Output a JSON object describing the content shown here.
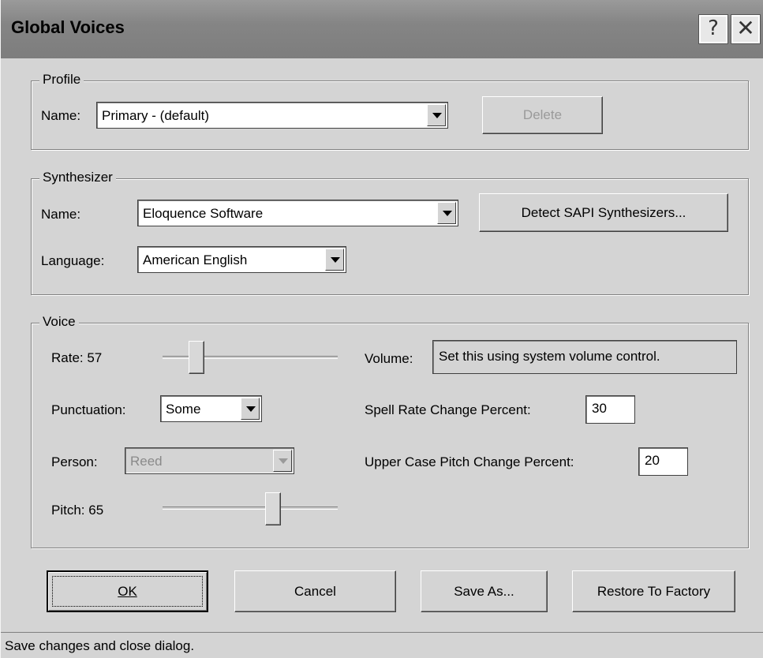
{
  "window": {
    "title": "Global Voices",
    "help_glyph": "?",
    "close_glyph": "✕"
  },
  "profile": {
    "group_label": "Profile",
    "name_label": "Name:",
    "name_value": "Primary - (default)",
    "delete_label": "Delete"
  },
  "synthesizer": {
    "group_label": "Synthesizer",
    "name_label": "Name:",
    "name_value": "Eloquence Software",
    "detect_label": "Detect SAPI Synthesizers...",
    "language_label": "Language:",
    "language_value": "American English"
  },
  "voice": {
    "group_label": "Voice",
    "rate_label": "Rate: 57",
    "rate_value": 57,
    "volume_label": "Volume:",
    "volume_value": "Set this using system volume control.",
    "punctuation_label": "Punctuation:",
    "punctuation_value": "Some",
    "spell_rate_label": "Spell Rate Change Percent:",
    "spell_rate_value": "30",
    "person_label": "Person:",
    "person_value": "Reed",
    "upper_case_label": "Upper Case Pitch Change Percent:",
    "upper_case_value": "20",
    "pitch_label": "Pitch:  65",
    "pitch_value": 65
  },
  "buttons": {
    "ok": "OK",
    "cancel": "Cancel",
    "save_as": "Save As...",
    "restore": "Restore To Factory"
  },
  "status": {
    "text": "Save changes and close dialog."
  }
}
